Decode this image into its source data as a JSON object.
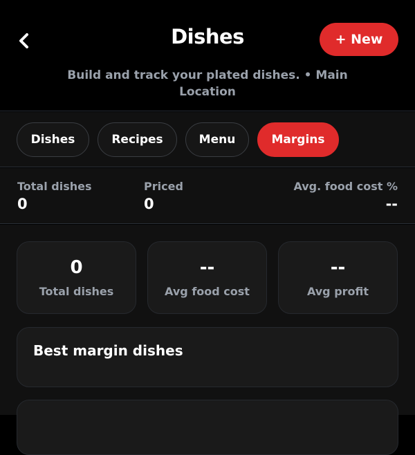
{
  "header": {
    "title": "Dishes",
    "new_button": "+ New",
    "subtitle": "Build and track your plated dishes. • Main Location"
  },
  "tabs": [
    {
      "label": "Dishes",
      "active": false
    },
    {
      "label": "Recipes",
      "active": false
    },
    {
      "label": "Menu",
      "active": false
    },
    {
      "label": "Margins",
      "active": true
    }
  ],
  "stats": {
    "total_dishes": {
      "label": "Total dishes",
      "value": "0"
    },
    "priced": {
      "label": "Priced",
      "value": "0"
    },
    "avg_food_cost_pct": {
      "label": "Avg. food cost %",
      "value": "--"
    }
  },
  "cards": {
    "total_dishes": {
      "value": "0",
      "label": "Total dishes"
    },
    "avg_food_cost": {
      "value": "--",
      "label": "Avg food cost"
    },
    "avg_profit": {
      "value": "--",
      "label": "Avg profit"
    }
  },
  "sections": {
    "best_margin": {
      "title": "Best margin dishes"
    }
  },
  "colors": {
    "accent": "#e02b2b",
    "background": "#000000",
    "panel": "#111111",
    "card": "#1a1a1a",
    "muted_text": "#9aa1ab"
  },
  "icons": {
    "back": "chevron-left-icon"
  }
}
